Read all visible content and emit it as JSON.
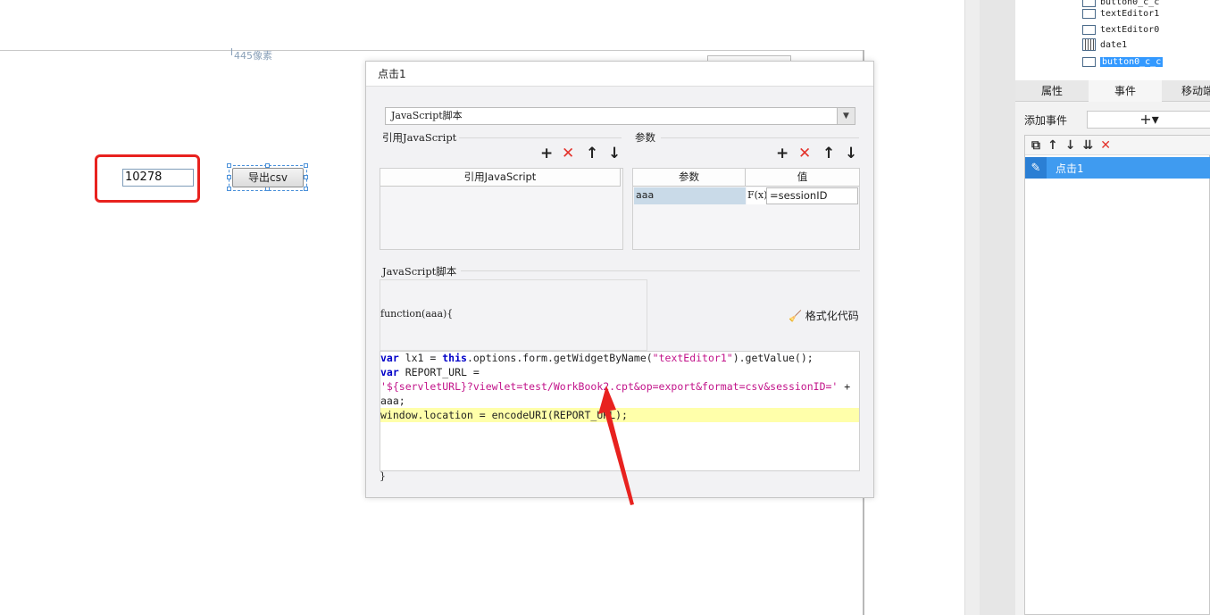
{
  "canvas": {
    "ruler_label": "445像素",
    "number_input_value": "10278",
    "export_button_label": "导出csv"
  },
  "widget_tree": {
    "items": [
      "button0_c_c",
      "textEditor1",
      "textEditor0",
      "date1",
      "button0_c_c"
    ],
    "selected": "button0_c_c"
  },
  "right_panel": {
    "tabs": [
      "属性",
      "事件",
      "移动端"
    ],
    "active_tab": "事件",
    "add_event_label": "添加事件",
    "add_event_symbol": "+▾",
    "events": [
      "点击1"
    ]
  },
  "dialog": {
    "title": "点击1",
    "type_value": "JavaScript脚本",
    "ref_js_group": "引用JavaScript",
    "ref_js_column": "引用JavaScript",
    "params_group": "参数",
    "params_columns": [
      "参数",
      "值"
    ],
    "params_rows": [
      {
        "name": "aaa",
        "formula_icon": "F(x)",
        "value": "=sessionID"
      }
    ],
    "script_group": "JavaScript脚本",
    "function_header": "function(aaa){",
    "format_button": "格式化代码",
    "closing_brace": "}",
    "code_lines": [
      "var lx1 = this.options.form.getWidgetByName(\"textEditor1\").getValue();",
      "var REPORT_URL =",
      "'${servletURL}?viewlet=test/WorkBook2.cpt&op=export&format=csv&sessionID=' +",
      "aaa;",
      "window.location = encodeURI(REPORT_URL);"
    ]
  },
  "colors": {
    "accent_blue": "#3f9bf0",
    "red_highlight": "#e8221f",
    "delete_red": "#e3322b"
  }
}
